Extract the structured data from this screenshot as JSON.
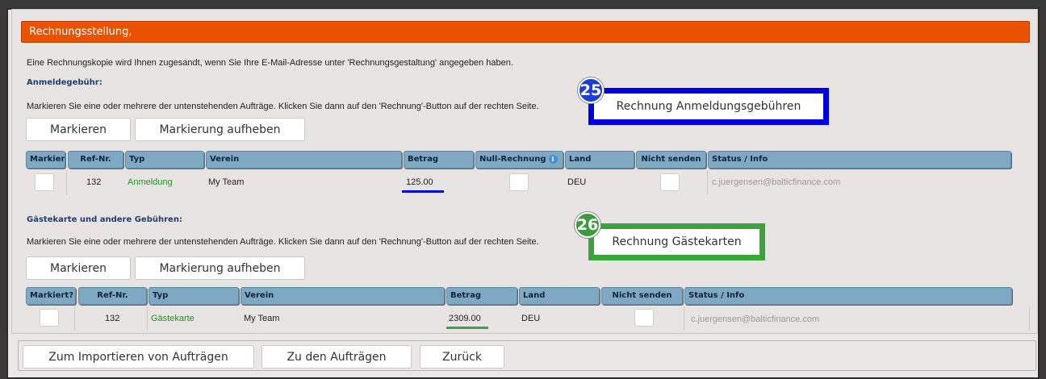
{
  "title": "Rechnungsstellung,",
  "intro_text": "Eine Rechnungskopie wird Ihnen zugesandt, wenn Sie Ihre E-Mail-Adresse unter 'Rechnungsgestaltung' angegeben haben.",
  "section1": {
    "title": "Anmeldegebühr:",
    "instruction": "Markieren Sie eine oder mehrere der untenstehenden Aufträge. Klicken Sie dann auf den 'Rechnung'-Button auf der rechten Seite.",
    "badge": "25",
    "invoice_button": "Rechnung Anmeldungsgebühren",
    "mark_button": "Markieren",
    "unmark_button": "Markierung aufheben",
    "headers": [
      "Markier",
      "Ref-Nr.",
      "Typ",
      "Verein",
      "Betrag",
      "Null-Rechnung",
      "Land",
      "Nicht senden",
      "Status / Info"
    ],
    "rows": [
      {
        "ref": "132",
        "typ": "Anmeldung",
        "verein": "My Team",
        "betrag": "125.00",
        "land": "DEU",
        "status": "c.juergensen@balticfinance.com"
      }
    ]
  },
  "section2": {
    "title": "Gästekarte und andere Gebühren:",
    "instruction": "Markieren Sie eine oder mehrere der untenstehenden Aufträge. Klicken Sie dann auf den 'Rechnung'-Button auf der rechten Seite.",
    "badge": "26",
    "invoice_button": "Rechnung Gästekarten",
    "mark_button": "Markieren",
    "unmark_button": "Markierung aufheben",
    "headers": [
      "Markiert?",
      "Ref-Nr.",
      "Typ",
      "Verein",
      "Betrag",
      "Land",
      "Nicht senden",
      "Status / Info"
    ],
    "rows": [
      {
        "ref": "132",
        "typ": "Gästekarte",
        "verein": "My Team",
        "betrag": "2309.00",
        "land": "DEU",
        "status": "c.juergensen@balticfinance.com"
      }
    ]
  },
  "footer": {
    "import_button": "Zum Importieren von Aufträgen",
    "orders_button": "Zu den Aufträgen",
    "back_button": "Zurück"
  },
  "colors": {
    "title_bar": "#e95200",
    "table_header": "#7fa9c2",
    "highlight_blue": "#0000e0",
    "highlight_green": "#3aa33a"
  }
}
